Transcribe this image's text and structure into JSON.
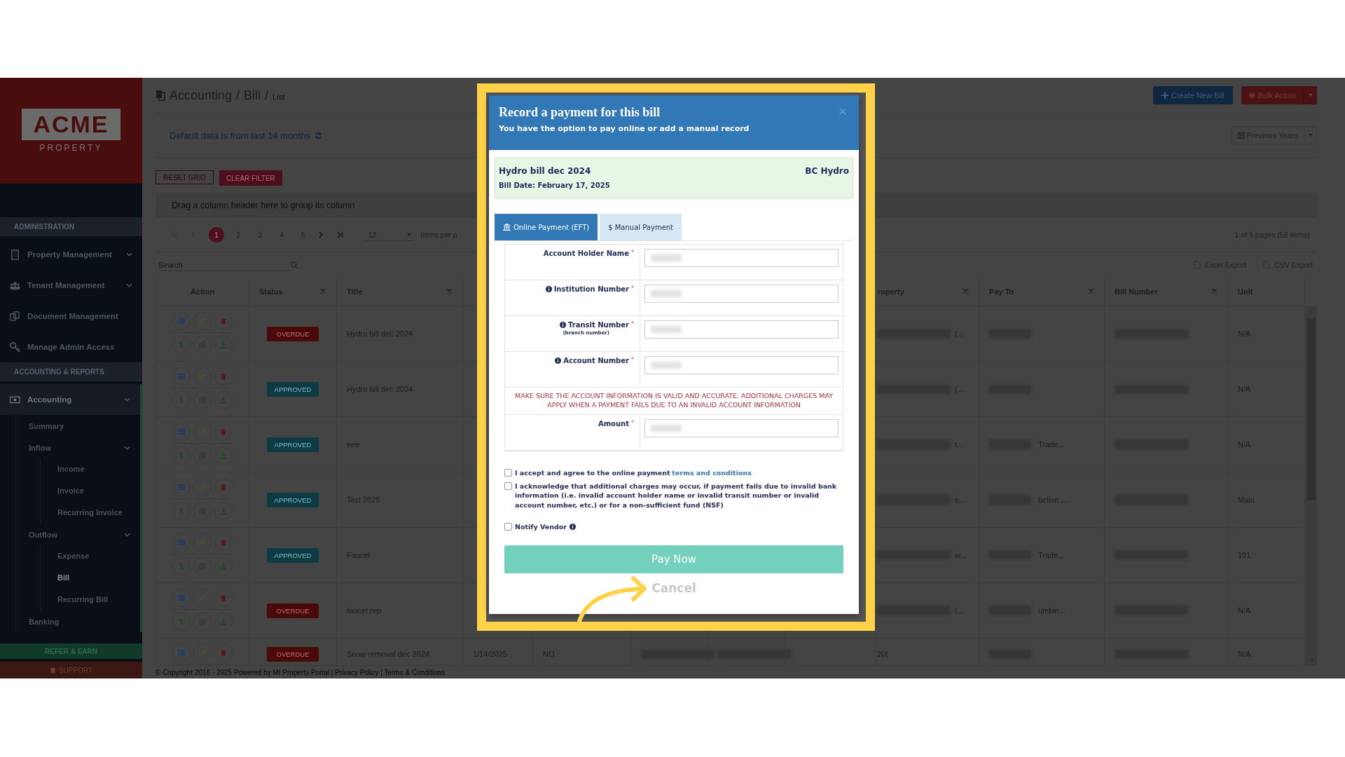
{
  "sidebar": {
    "logo": {
      "name": "ACME",
      "tagline": "PROPERTY"
    },
    "sections": [
      {
        "title": "ADMINISTRATION",
        "items": [
          {
            "label": "Property Management",
            "expandable": true,
            "selected": false
          },
          {
            "label": "Tenant Management",
            "expandable": true,
            "selected": false
          },
          {
            "label": "Document Management",
            "expandable": false,
            "selected": false
          },
          {
            "label": "Manage Admin Access",
            "expandable": false,
            "selected": false
          }
        ]
      },
      {
        "title": "ACCOUNTING & REPORTS",
        "items": [
          {
            "label": "Accounting",
            "expandable": true,
            "selected": true,
            "children": [
              {
                "label": "Summary",
                "expandable": false,
                "selected": false
              },
              {
                "label": "Inflow",
                "expandable": true,
                "selected": false,
                "children": [
                  {
                    "label": "Income",
                    "selected": false
                  },
                  {
                    "label": "Invoice",
                    "selected": false
                  },
                  {
                    "label": "Recurring Invoice",
                    "selected": false
                  }
                ]
              },
              {
                "label": "Outflow",
                "expandable": true,
                "selected": false,
                "children": [
                  {
                    "label": "Expense",
                    "selected": false
                  },
                  {
                    "label": "Bill",
                    "selected": true
                  },
                  {
                    "label": "Recurring Bill",
                    "selected": false
                  }
                ]
              },
              {
                "label": "Banking",
                "expandable": false,
                "selected": false
              }
            ]
          }
        ]
      }
    ],
    "refer_button": "REFER & EARN",
    "support_button": "SUPPORT"
  },
  "breadcrumb": {
    "separator": "/",
    "items": [
      "Accounting",
      "Bill",
      "List"
    ]
  },
  "header_buttons": [
    {
      "label": "Create New Bill",
      "kind": "create"
    },
    {
      "label": "Bulk Action",
      "kind": "bulk"
    }
  ],
  "info": "Default data is from last 14 months",
  "period_button": "Previous Years",
  "grid_buttons": [
    {
      "label": "RESET GRID",
      "kind": "outline"
    },
    {
      "label": "CLEAR FILTER",
      "kind": "solid"
    }
  ],
  "group_panel": "Drag a column header here to group its column",
  "pager": {
    "pages": [
      {
        "label": "1",
        "selected": true
      },
      {
        "label": "2",
        "selected": false
      },
      {
        "label": "3",
        "selected": false
      },
      {
        "label": "4",
        "selected": false
      },
      {
        "label": "5",
        "selected": false
      }
    ],
    "page_size": "12",
    "page_size_label": "Items per p",
    "summary": "1 of 5 pages (58 items)"
  },
  "search": {
    "placeholder": "Search"
  },
  "exports": [
    "Excel Export",
    "CSV Export"
  ],
  "columns": [
    {
      "label": "Action",
      "filter": false
    },
    {
      "label": "Status",
      "filter": true
    },
    {
      "label": "Title",
      "filter": true
    },
    {
      "label": "roperty",
      "filter": true
    },
    {
      "label": "Pay To",
      "filter": true
    },
    {
      "label": "Bill Number",
      "filter": true
    },
    {
      "label": "Unit",
      "filter": false
    }
  ],
  "rows": [
    {
      "status": {
        "label": "OVERDUE",
        "kind": "overdue"
      },
      "title": "Hydro bill dec 2024",
      "property": "(...",
      "unit": "N/A"
    },
    {
      "status": {
        "label": "APPROVED",
        "kind": "approved"
      },
      "title": "Hydro bill dec 2024",
      "property": "(...",
      "unit": "N/A"
    },
    {
      "status": {
        "label": "APPROVED",
        "kind": "approved"
      },
      "title": "eee",
      "property": "t...",
      "pay_to": "Trade...",
      "unit": "N/A"
    },
    {
      "status": {
        "label": "APPROVED",
        "kind": "approved"
      },
      "title": "Test 2025",
      "property": "e...",
      "pay_to": "belion ...",
      "unit": "Main"
    },
    {
      "status": {
        "label": "APPROVED",
        "kind": "approved"
      },
      "title": "Faucet",
      "property": "w...",
      "pay_to": "Trade...",
      "unit": "101"
    },
    {
      "status": {
        "label": "OVERDUE",
        "kind": "overdue"
      },
      "title": "faucet rep",
      "property": "(...",
      "pay_to": "umbin...",
      "unit": "N/A"
    },
    {
      "status": {
        "label": "OVERDUE",
        "kind": "overdue"
      },
      "title": "Snow removal dec 2024",
      "date": "1/14/2025",
      "column_5": "NO",
      "property": "20(",
      "unit": "N/A"
    }
  ],
  "footer": "© Copyright 2016 - 2025 Powered by MI Property Portal | Privacy Policy | Terms & Conditions",
  "modal": {
    "title": "Record a payment for this bill",
    "subtitle": "You have the option to pay online or add a manual record",
    "bill": {
      "title": "Hydro bill dec 2024",
      "vendor": "BC Hydro",
      "date": "Bill Date: February 17, 2025"
    },
    "tabs": [
      {
        "label": "Online Payment (EFT)",
        "selected": true
      },
      {
        "label": "$ Manual Payment",
        "selected": false
      }
    ],
    "required_mark": "*",
    "fields": [
      {
        "kind": "input",
        "label": "Account Holder Name",
        "info": false,
        "required": true
      },
      {
        "kind": "input",
        "label": "Institution Number",
        "info": true,
        "required": true
      },
      {
        "kind": "input",
        "label": "Transit Number",
        "hint": "(branch number)",
        "info": true,
        "required": true
      },
      {
        "kind": "input",
        "label": "Account Number",
        "info": true,
        "required": true
      },
      {
        "kind": "warning",
        "text": "MAKE SURE THE ACCOUNT INFORMATION IS VALID AND ACCURATE. ADDITIONAL CHARGES MAY APPLY WHEN A PAYMENT FAILS DUE TO AN INVALID ACCOUNT INFORMATION"
      },
      {
        "kind": "input",
        "label": "Amount",
        "info": false,
        "required": true
      }
    ],
    "checkboxes": [
      {
        "text": "I accept and agree to the online payment",
        "link": "terms and conditions",
        "checked": false
      },
      {
        "text": "I acknowledge that additional charges may occur, if payment fails due to invalid bank information (i.e. invalid account holder name or invalid transit number or invalid account number, etc.) or for a non-sufficient fund (NSF)",
        "checked": false
      },
      {
        "text": "Notify Vendor",
        "checked": false,
        "info": true
      }
    ],
    "pay_button": "Pay Now",
    "cancel_button": "Cancel"
  }
}
